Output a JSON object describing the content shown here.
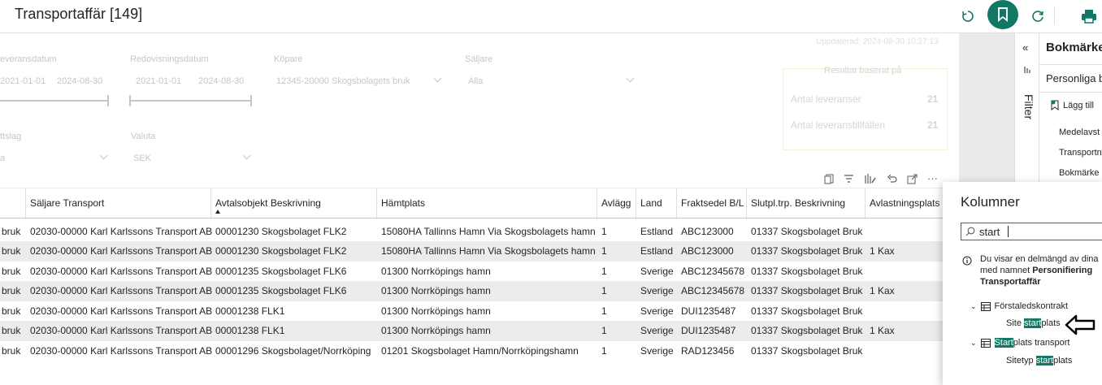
{
  "header": {
    "title": "Transportaffär [149]"
  },
  "report": {
    "updated": "Uppdaterad: 2024-08-30 10:27:13",
    "filters": {
      "leveransdatum": {
        "label": "everansdatum",
        "from": "2021-01-01",
        "to": "2024-08-30"
      },
      "redovisningsdatum": {
        "label": "Redovisningsdatum",
        "from": "2021-01-01",
        "to": "2024-08-30"
      },
      "kopare": {
        "label": "Köpare",
        "value": "12345-20000 Skogsbolagets bruk"
      },
      "saljare": {
        "label": "Säljare",
        "value": "Alla"
      },
      "artslag": {
        "label": "ttslag",
        "value": "a"
      },
      "valuta": {
        "label": "Valuta",
        "value": "SEK"
      }
    },
    "result": {
      "title": "Resultat baserat på",
      "rows": [
        {
          "label": "Antal leveranser",
          "value": "21"
        },
        {
          "label": "Antal leveranstillfällen",
          "value": "21"
        }
      ]
    },
    "table": {
      "headers": [
        "Säljare Transport",
        "Avtalsobjekt Beskrivning",
        "Hämtplats",
        "Avlägg",
        "Land",
        "Fraktsedel B/L",
        "Slutpl.trp. Beskrivning",
        "Avlastningsplats"
      ],
      "rows": [
        [
          "bruk",
          "02030-00000 Karl Karlssons Transport AB",
          "00001230 Skogsbolaget FLK2",
          "15080HA Tallinns Hamn Via Skogsbolagets hamn",
          "1",
          "Estland",
          "ABC123000",
          "01337 Skogsbolaget Bruk",
          ""
        ],
        [
          "bruk",
          "02030-00000 Karl Karlssons Transport AB",
          "00001230 Skogsbolaget FLK2",
          "15080HA Tallinns Hamn Via Skogsbolagets hamn",
          "1",
          "Estland",
          "ABC123000",
          "01337 Skogsbolaget Bruk",
          "1 Kax"
        ],
        [
          "bruk",
          "02030-00000 Karl Karlssons Transport AB",
          "00001235 Skogsbolaget FLK6",
          "01300 Norrköpings hamn",
          "1",
          "Sverige",
          "ABC12345678",
          "01337 Skogsbolaget Bruk",
          ""
        ],
        [
          "bruk",
          "02030-00000 Karl Karlssons Transport AB",
          "00001235 Skogsbolaget FLK6",
          "01300 Norrköpings hamn",
          "1",
          "Sverige",
          "ABC12345678",
          "01337 Skogsbolaget Bruk",
          "1 Kax"
        ],
        [
          "bruk",
          "02030-00000 Karl Karlssons Transport AB",
          "00001238 FLK1",
          "01300 Norrköpings hamn",
          "1",
          "Sverige",
          "DUI1235487",
          "01337 Skogsbolaget Bruk",
          ""
        ],
        [
          "bruk",
          "02030-00000 Karl Karlssons Transport AB",
          "00001238 FLK1",
          "01300 Norrköpings hamn",
          "1",
          "Sverige",
          "DUI1235487",
          "01337 Skogsbolaget Bruk",
          "1 Kax"
        ],
        [
          "bruk",
          "02030-00000 Karl Karlssons Transport AB",
          "00001296 Skogsbolaget/Norrköping",
          "01201 Skogsbolaget Hamn/Norrköpingshamn",
          "1",
          "Sverige",
          "RAD123456",
          "01337 Skogsbolaget Bruk",
          ""
        ]
      ]
    }
  },
  "side": {
    "filter_label": "Filter",
    "bookmarks_title": "Bokmärke",
    "personal": "Personliga b",
    "add_label": "Lägg till",
    "items": [
      "Medelavst",
      "Transportn",
      "Bokmärke"
    ]
  },
  "columns": {
    "title": "Kolumner",
    "search_value": "start",
    "info": "Du visar en delmängd av dina",
    "info_line2": "med namnet",
    "info_bold": "Personifiering",
    "info_bold2": "Transportaffär",
    "group1": "Förstaledskontrakt",
    "group1_item_pre": "Site ",
    "group1_item_hl": "start",
    "group1_item_post": "plats",
    "group2_hl": "Start",
    "group2_post": "plats transport",
    "group2_item_pre": "Sitetyp ",
    "group2_item_hl": "start",
    "group2_item_post": "plats"
  }
}
